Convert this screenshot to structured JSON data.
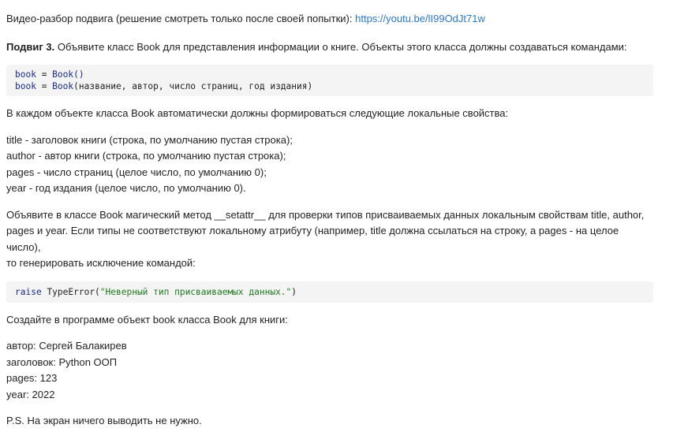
{
  "video": {
    "prefix": "Видео-разбор подвига (решение смотреть только после своей попытки): ",
    "url": "https://youtu.be/lI99OdJt71w"
  },
  "task": {
    "label": "Подвиг 3.",
    "text": " Объявите класс Book для представления информации о книге. Объекты этого класса должны создаваться командами:"
  },
  "code1": {
    "line1": {
      "var": "book",
      "op": " = ",
      "cls": "Book",
      "args": "()"
    },
    "line2": {
      "var": "book",
      "op": " = ",
      "cls": "Book",
      "args": "(название, автор, число страниц, год издания)"
    }
  },
  "props_intro": "В каждом объекте класса Book автоматически должны формироваться следующие локальные свойства:",
  "props": [
    "title - заголовок книги (строка, по умолчанию пустая строка);",
    "author - автор книги (строка, по умолчанию пустая строка);",
    "pages - число страниц (целое число, по умолчанию 0);",
    "year - год издания (целое число, по умолчанию 0)."
  ],
  "setattr_text": {
    "line1": "Объявите в классе Book магический метод __setattr__ для проверки типов присваиваемых данных локальным свойствам title, author,",
    "line2": "pages и year. Если типы не соответствуют локальному атрибуту (например, title должна ссылаться на строку, a pages - на целое число),",
    "line3": "то генерировать исключение командой:"
  },
  "code2": {
    "keyword": "raise",
    "space": " ",
    "exc": "TypeError(",
    "string": "\"Неверный тип присваиваемых данных.\"",
    "close": ")"
  },
  "create_intro": "Создайте в программе объект book класса Book для книги:",
  "book_info": [
    "автор: Сергей Балакирев",
    "заголовок: Python ООП",
    "pages: 123",
    "year: 2022"
  ],
  "ps": "P.S. На экран ничего выводить не нужно.",
  "colors": {
    "link": "#2a77d0",
    "code_bg": "#f4f4f4",
    "code_keyword": "#1a2a8a",
    "code_string": "#1f7a1f"
  }
}
